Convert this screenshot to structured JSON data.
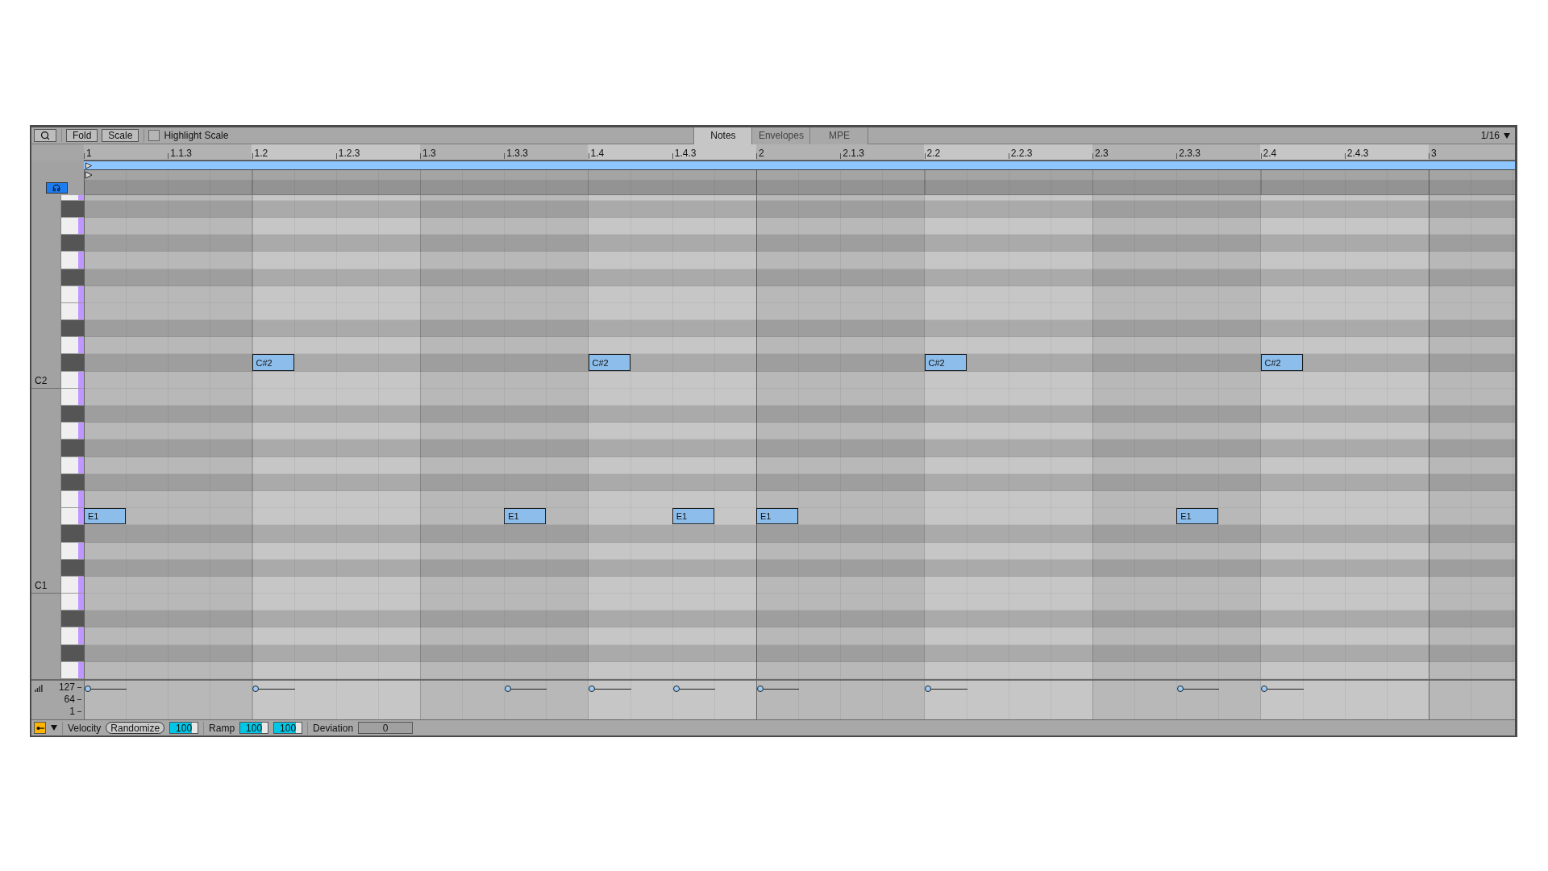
{
  "toolbar": {
    "buttons": [
      {
        "kind": "search"
      },
      {
        "kind": "text",
        "label": "Fold"
      },
      {
        "kind": "text",
        "label": "Scale"
      }
    ],
    "highlight_scale": {
      "label": "Highlight Scale",
      "checked": false
    }
  },
  "tabs": [
    {
      "label": "Notes",
      "selected": true
    },
    {
      "label": "Envelopes",
      "selected": false
    },
    {
      "label": "MPE",
      "selected": false
    }
  ],
  "grid_setting": {
    "label": "1/16"
  },
  "ruler": [
    "1",
    "1.1.3",
    "1.2",
    "1.2.3",
    "1.3",
    "1.3.3",
    "1.4",
    "1.4.3",
    "2",
    "2.1.3",
    "2.2",
    "2.2.3",
    "2.3",
    "2.3.3",
    "2.4",
    "2.4.3",
    "3"
  ],
  "preview": {
    "on": true
  },
  "keys": [
    {
      "kind": "white"
    },
    {
      "kind": "black"
    },
    {
      "kind": "white"
    },
    {
      "kind": "black"
    },
    {
      "kind": "white"
    },
    {
      "kind": "black"
    },
    {
      "kind": "white"
    },
    {
      "kind": "white"
    },
    {
      "kind": "black"
    },
    {
      "kind": "white"
    },
    {
      "kind": "black",
      "steps": [
        {
          "note": false
        },
        {
          "note": false
        },
        {
          "note": false
        },
        {
          "note": false
        },
        {
          "note": true,
          "label": "C#2"
        },
        {
          "note": false
        },
        {
          "note": false
        },
        {
          "note": false
        },
        {
          "note": false
        },
        {
          "note": false
        },
        {
          "note": false
        },
        {
          "note": false
        },
        {
          "note": true,
          "label": "C#2"
        },
        {
          "note": false
        },
        {
          "note": false
        },
        {
          "note": false
        },
        {
          "note": false
        },
        {
          "note": false
        },
        {
          "note": false
        },
        {
          "note": false
        },
        {
          "note": true,
          "label": "C#2"
        },
        {
          "note": false
        },
        {
          "note": false
        },
        {
          "note": false
        },
        {
          "note": false
        },
        {
          "note": false
        },
        {
          "note": false
        },
        {
          "note": false
        },
        {
          "note": true,
          "label": "C#2"
        },
        {
          "note": false
        },
        {
          "note": false
        },
        {
          "note": false
        },
        {
          "note": false
        },
        {
          "note": false
        }
      ]
    },
    {
      "kind": "white",
      "label": "C2"
    },
    {
      "kind": "white"
    },
    {
      "kind": "black"
    },
    {
      "kind": "white"
    },
    {
      "kind": "black"
    },
    {
      "kind": "white"
    },
    {
      "kind": "black"
    },
    {
      "kind": "white"
    },
    {
      "kind": "white",
      "steps": [
        {
          "note": true,
          "label": "E1"
        },
        {
          "note": false
        },
        {
          "note": false
        },
        {
          "note": false
        },
        {
          "note": false
        },
        {
          "note": false
        },
        {
          "note": false
        },
        {
          "note": false
        },
        {
          "note": false
        },
        {
          "note": false
        },
        {
          "note": true,
          "label": "E1"
        },
        {
          "note": false
        },
        {
          "note": false
        },
        {
          "note": false
        },
        {
          "note": true,
          "label": "E1"
        },
        {
          "note": false
        },
        {
          "note": true,
          "label": "E1"
        },
        {
          "note": false
        },
        {
          "note": false
        },
        {
          "note": false
        },
        {
          "note": false
        },
        {
          "note": false
        },
        {
          "note": false
        },
        {
          "note": false
        },
        {
          "note": false
        },
        {
          "note": false
        },
        {
          "note": true,
          "label": "E1"
        },
        {
          "note": false
        },
        {
          "note": false
        },
        {
          "note": false
        },
        {
          "note": false
        },
        {
          "note": false
        },
        {
          "note": false
        },
        {
          "note": false
        }
      ]
    },
    {
      "kind": "black"
    },
    {
      "kind": "white"
    },
    {
      "kind": "black"
    },
    {
      "kind": "white",
      "label": "C1"
    },
    {
      "kind": "white"
    },
    {
      "kind": "black"
    },
    {
      "kind": "white"
    },
    {
      "kind": "black"
    },
    {
      "kind": "white"
    }
  ],
  "velocity_lane": {
    "labels": [
      "127",
      "64",
      "1"
    ]
  },
  "footer": {
    "draw_mode": {
      "on": true
    },
    "velocity_label": "Velocity",
    "randomize": "Randomize",
    "velocity_field": {
      "value": "100",
      "level": 0.79
    },
    "ramp_label": "Ramp",
    "ramp_fields": [
      {
        "value": "100",
        "level": 0.79
      },
      {
        "value": "100",
        "level": 0.79
      }
    ],
    "deviation_label": "Deviation",
    "deviation_field": {
      "value": "0"
    }
  }
}
